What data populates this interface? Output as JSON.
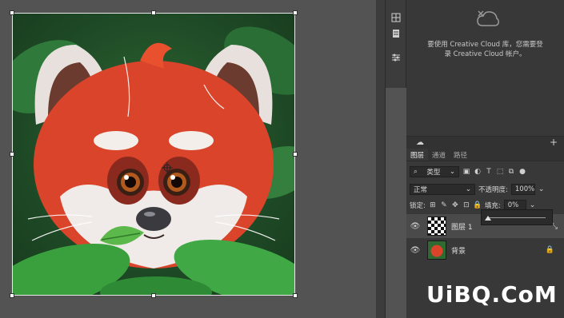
{
  "cc_panel": {
    "message_line1": "要使用 Creative Cloud 库，您需要登",
    "message_line2": "录 Creative Cloud 帐户。"
  },
  "layers_panel": {
    "tabs": [
      "图层",
      "通道",
      "路径"
    ],
    "filter_kind": "类型",
    "blend_mode": "正常",
    "opacity_label": "不透明度:",
    "opacity_value": "100%",
    "lock_label": "锁定:",
    "fill_label": "填充:",
    "fill_value": "0%",
    "fill_slider_level": 0,
    "layers": [
      {
        "name": "图层 1",
        "selected": true
      },
      {
        "name": "背景",
        "selected": false,
        "locked": true
      }
    ]
  },
  "watermark": "UiBQ.CoM",
  "colors": {
    "panel_bg": "#383838",
    "canvas_bg": "#535353",
    "watermark": "#ffffff",
    "red_panda_fur": "#d9442a"
  }
}
